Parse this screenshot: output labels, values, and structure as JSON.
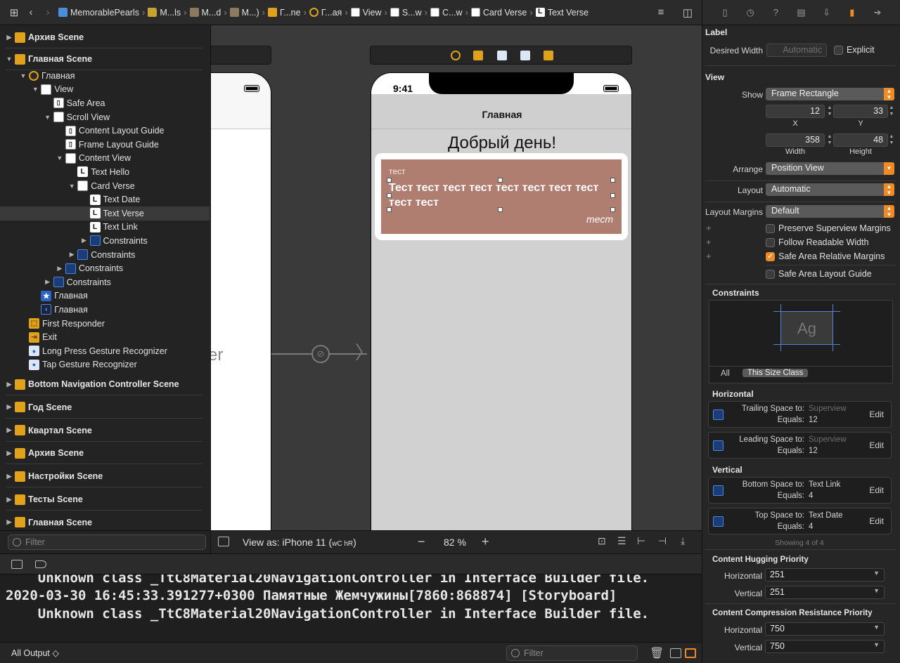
{
  "breadcrumb": [
    "MemorablePearls",
    "M...ls",
    "M...d",
    "M...)",
    "Г...ne",
    "Г...ая",
    "View",
    "S...w",
    "C...w",
    "Card Verse",
    "Text Verse"
  ],
  "outline": {
    "rows": [
      {
        "label": "Архив Scene",
        "kind": "scene"
      },
      {
        "label": "Главная Scene",
        "kind": "scene"
      },
      {
        "label": "Главная",
        "kind": "vc"
      },
      {
        "label": "View",
        "kind": "view"
      },
      {
        "label": "Safe Area",
        "kind": "guide"
      },
      {
        "label": "Scroll View",
        "kind": "view"
      },
      {
        "label": "Content Layout Guide",
        "kind": "guide"
      },
      {
        "label": "Frame Layout Guide",
        "kind": "guide"
      },
      {
        "label": "Content View",
        "kind": "view"
      },
      {
        "label": "Text Hello",
        "kind": "L"
      },
      {
        "label": "Card Verse",
        "kind": "view"
      },
      {
        "label": "Text Date",
        "kind": "L"
      },
      {
        "label": "Text Verse",
        "kind": "L"
      },
      {
        "label": "Text Link",
        "kind": "L"
      },
      {
        "label": "Constraints",
        "kind": "cons"
      },
      {
        "label": "Constraints",
        "kind": "cons"
      },
      {
        "label": "Constraints",
        "kind": "cons"
      },
      {
        "label": "Constraints",
        "kind": "cons"
      },
      {
        "label": "Главная",
        "kind": "star"
      },
      {
        "label": "Главная",
        "kind": "back"
      },
      {
        "label": "First Responder",
        "kind": "fr"
      },
      {
        "label": "Exit",
        "kind": "exit"
      },
      {
        "label": "Long Press Gesture Recognizer",
        "kind": "gest"
      },
      {
        "label": "Tap Gesture Recognizer",
        "kind": "gest"
      }
    ],
    "scenes": [
      "Bottom Navigation Controller Scene",
      "Год Scene",
      "Квартал Scene",
      "Архив Scene",
      "Настройки Scene",
      "Тесты Scene",
      "Главная Scene"
    ],
    "filter_placeholder": "Filter"
  },
  "canvas": {
    "status_time": "9:41",
    "nav_title": "Главная",
    "hello_text": "Добрый день!",
    "card_date": "тест",
    "card_verse": "Тест тест тест тест тест тест тест тест тест тест",
    "card_link": "тест",
    "left_ghost_text": "er",
    "view_as": "View as: iPhone 11 (",
    "size_class": "wC hR",
    "view_as_end": ")",
    "zoom": "82 %",
    "zoom_minus": "−",
    "zoom_plus": "+"
  },
  "console": {
    "lines": [
      "    Unknown class _TtC8Material20NavigationController in Interface Builder file.",
      "2020-03-30 16:45:33.391277+0300 Памятные Жемчужины[7860:868874] [Storyboard]",
      "    Unknown class _TtC8Material20NavigationController in Interface Builder file."
    ],
    "output_selector": "All Output ◇",
    "filter_placeholder": "Filter"
  },
  "inspector": {
    "label_section": "Label",
    "desired_width_label": "Desired Width",
    "desired_width_value": "Automatic",
    "explicit_label": "Explicit",
    "view_section": "View",
    "show_label": "Show",
    "show_value": "Frame Rectangle",
    "x_value": "12",
    "y_value": "33",
    "x_label": "X",
    "y_label": "Y",
    "width_value": "358",
    "height_value": "48",
    "width_label": "Width",
    "height_label": "Height",
    "arrange_label": "Arrange",
    "arrange_value": "Position View",
    "layout_label": "Layout",
    "layout_value": "Automatic",
    "layout_margins_label": "Layout Margins",
    "layout_margins_value": "Default",
    "cb_preserve": "Preserve Superview Margins",
    "cb_readable": "Follow Readable Width",
    "cb_safe_rel": "Safe Area Relative Margins",
    "cb_safe_guide": "Safe Area Layout Guide",
    "plus": "+",
    "constraints_section": "Constraints",
    "ag_label": "Ag",
    "all_tab": "All",
    "size_class_tab": "This Size Class",
    "horizontal_section": "Horizontal",
    "vertical_section": "Vertical",
    "constraints": [
      {
        "title": "Trailing Space to:",
        "target": "Superview",
        "equals_label": "Equals:",
        "equals": "12",
        "edit": "Edit"
      },
      {
        "title": "Leading Space to:",
        "target": "Superview",
        "equals_label": "Equals:",
        "equals": "12",
        "edit": "Edit"
      },
      {
        "title": "Bottom Space to:",
        "target": "Text Link",
        "equals_label": "Equals:",
        "equals": "4",
        "edit": "Edit"
      },
      {
        "title": "Top Space to:",
        "target": "Text Date",
        "equals_label": "Equals:",
        "equals": "4",
        "edit": "Edit"
      }
    ],
    "showing": "Showing 4 of 4",
    "hugging_section": "Content Hugging Priority",
    "hug_h_label": "Horizontal",
    "hug_h_value": "251",
    "hug_v_label": "Vertical",
    "hug_v_value": "251",
    "compression_section": "Content Compression Resistance Priority",
    "comp_h_label": "Horizontal",
    "comp_h_value": "750",
    "comp_v_label": "Vertical",
    "comp_v_value": "750"
  },
  "colors": {
    "accent": "#f08a24",
    "card": "#b07e70",
    "canvas": "#3a3a3a"
  }
}
